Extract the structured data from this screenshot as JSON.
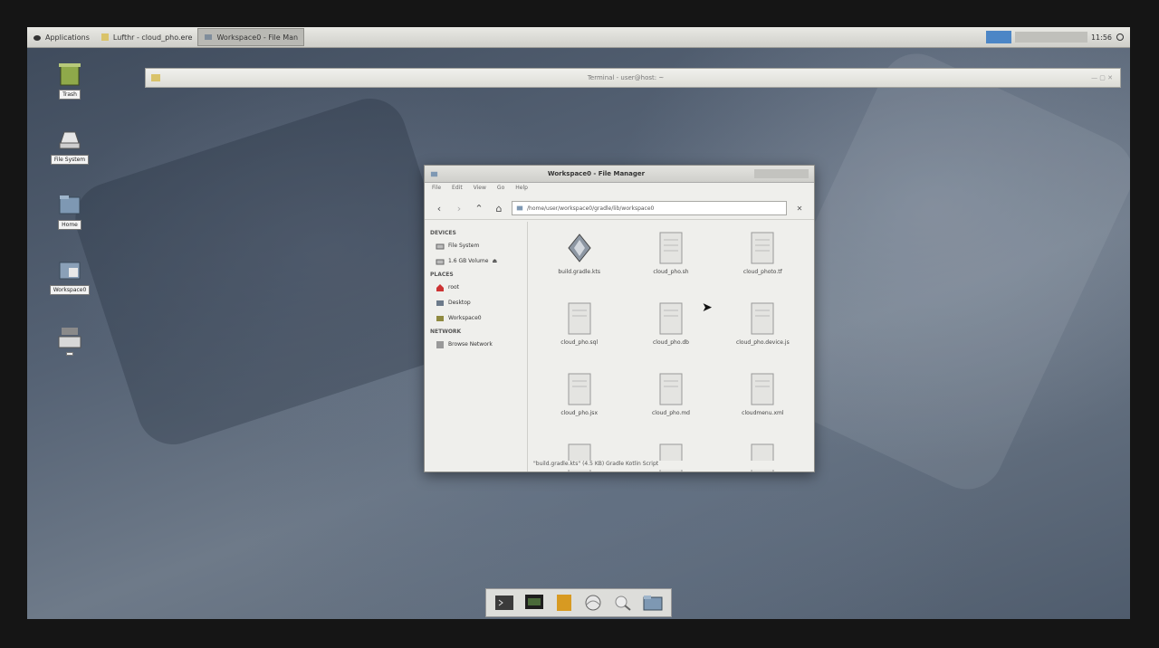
{
  "panel": {
    "apps_menu": "Applications",
    "task1": "Lufthr - cloud_pho.ere",
    "task2": "Workspace0 - File Man",
    "clock": "11:56"
  },
  "desktop_icons": [
    "Trash",
    "File System",
    "Home",
    "Workspace0",
    ""
  ],
  "top_window": {
    "title": "Terminal - user@host: ~"
  },
  "file_manager": {
    "title": "Workspace0 - File Manager",
    "menu": [
      "File",
      "Edit",
      "View",
      "Go",
      "Help"
    ],
    "address": "/home/user/workspace0/gradle/lib/workspace0",
    "sidebar": {
      "devices_header": "DEVICES",
      "devices": [
        "File System",
        "1.6 GB Volume"
      ],
      "places_header": "PLACES",
      "places": [
        "root",
        "Desktop",
        "Workspace0"
      ],
      "network_header": "NETWORK",
      "network": [
        "Browse Network"
      ]
    },
    "files": [
      "build.gradle.kts",
      "cloud_pho.sh",
      "cloud_photo.tf",
      "cloud_pho.sql",
      "cloud_pho.db",
      "cloud_pho.device.js",
      "cloud_pho.jsx",
      "cloud_pho.md",
      "cloudmenu.xml",
      "",
      "",
      ""
    ],
    "status": "\"build.gradle.kts\" (4.5 KB) Gradle Kotlin Script"
  },
  "dock": [
    "terminal-icon",
    "monitor-icon",
    "archive-icon",
    "browser-icon",
    "search-icon",
    "folder-icon"
  ]
}
